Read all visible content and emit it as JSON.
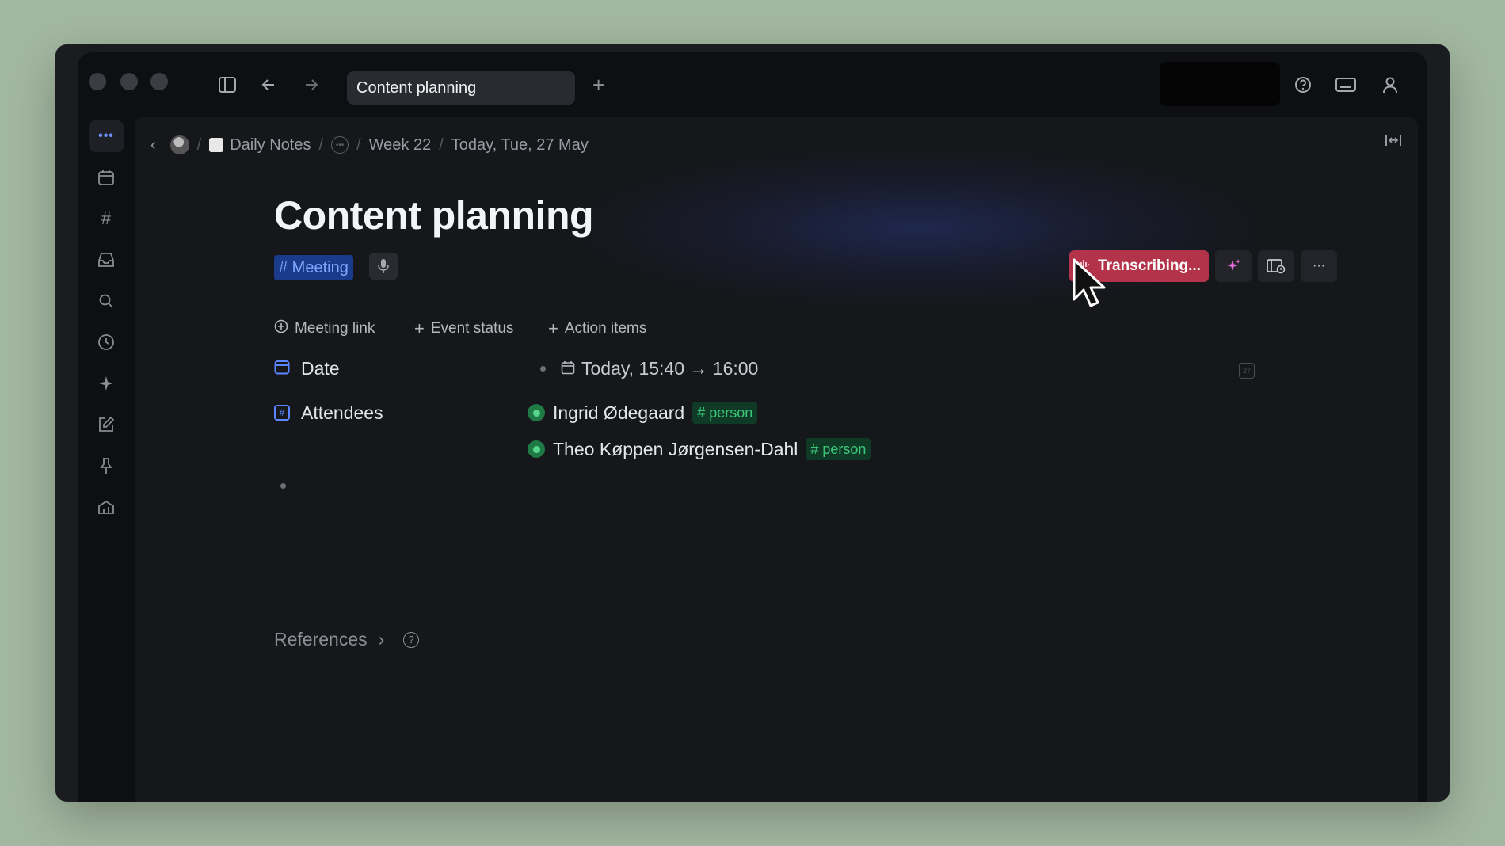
{
  "titlebar": {
    "tab_title": "Content planning",
    "new_tab_label": "+"
  },
  "breadcrumb": {
    "items": [
      "Daily Notes",
      "Week 22",
      "Today, Tue, 27 May"
    ],
    "separator": "/"
  },
  "page": {
    "title": "Content planning",
    "tag": "# Meeting"
  },
  "toolbar": {
    "transcribe_label": "Transcribing...",
    "more_label": "···"
  },
  "properties": {
    "add_buttons": [
      "Meeting link",
      "Event status",
      "Action items"
    ],
    "date_label": "Date",
    "date_value": "Today, 15:40 → 16:00",
    "attendees_label": "Attendees",
    "attendees": [
      {
        "name": "Ingrid Ødegaard",
        "tag": "# person"
      },
      {
        "name": "Theo Køppen Jørgensen-Dahl",
        "tag": "# person"
      }
    ]
  },
  "references": {
    "label": "References",
    "chevron": "›"
  },
  "colors": {
    "accent_blue": "#5a86ff",
    "transcribe_red": "#b3334a",
    "person_green": "#3ec77a"
  },
  "icons": [
    "sidebar-toggle-icon",
    "back-arrow-icon",
    "forward-arrow-icon",
    "help-icon",
    "keyboard-icon",
    "account-icon",
    "calendar-icon",
    "hashtag-icon",
    "inbox-icon",
    "search-icon",
    "clock-icon",
    "sparkle-icon",
    "edit-icon",
    "pin-icon",
    "dashboard-icon",
    "mic-icon",
    "waveform-icon",
    "layout-icon",
    "expand-icon"
  ]
}
